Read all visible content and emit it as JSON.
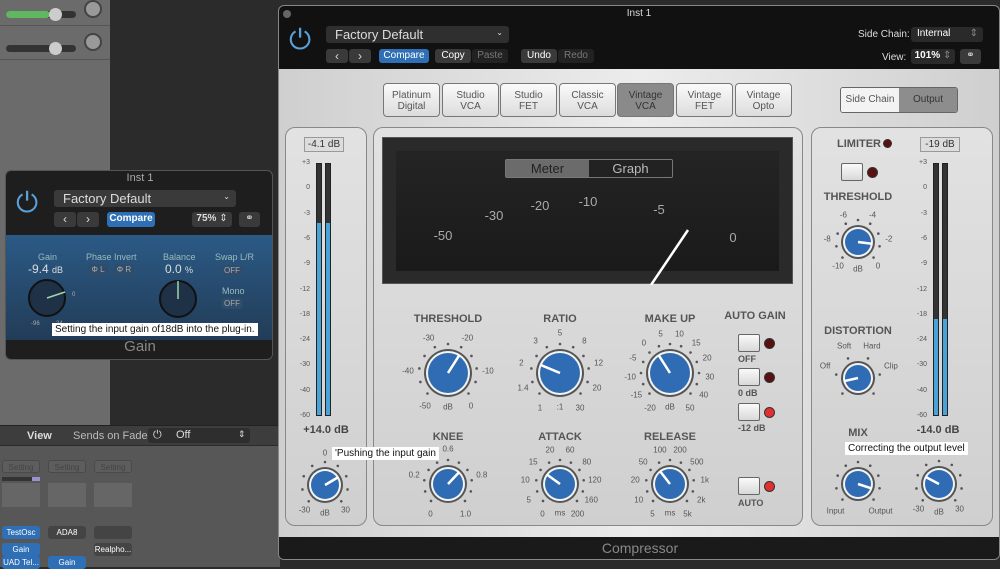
{
  "daw": {
    "mixer_bar": {
      "view_label": "View",
      "sends_label": "Sends on Faders:",
      "sends_value": "Off"
    },
    "strips": [
      {
        "setting": "Setting",
        "name": "TestOsc",
        "insert": "Gain",
        "insert2": "UAD Tel..."
      },
      {
        "setting": "Setting",
        "name": "ADA8",
        "insert": "Gain"
      },
      {
        "setting": "Setting",
        "name": "",
        "insert": "Realpho..."
      }
    ]
  },
  "gain_plugin": {
    "title": "Inst 1",
    "preset": "Factory Default",
    "compare": "Compare",
    "zoom": "75%",
    "gain_label": "Gain",
    "gain_value": "-9.4",
    "gain_unit": "dB",
    "gain_min": "-96",
    "gain_max": "24",
    "gain_zero": "0",
    "phase_label": "Phase Invert",
    "phase_l": "L",
    "phase_r": "R",
    "balance_label": "Balance",
    "balance_value": "0.0",
    "balance_unit": "%",
    "swap_label": "Swap L/R",
    "swap_value": "OFF",
    "mono_label": "Mono",
    "mono_value": "OFF",
    "footer": "Gain",
    "tooltip": "Setting the input gain of18dB into the plug-in."
  },
  "compressor": {
    "title": "Inst 1",
    "preset": "Factory Default",
    "compare": "Compare",
    "copy": "Copy",
    "paste": "Paste",
    "undo": "Undo",
    "redo": "Redo",
    "side_chain_label": "Side Chain:",
    "side_chain_value": "Internal",
    "view_label": "View:",
    "view_value": "101%",
    "models": [
      [
        "Platinum",
        "Digital"
      ],
      [
        "Studio",
        "VCA"
      ],
      [
        "Studio",
        "FET"
      ],
      [
        "Classic",
        "VCA"
      ],
      [
        "Vintage",
        "VCA"
      ],
      [
        "Vintage",
        "FET"
      ],
      [
        "Vintage",
        "Opto"
      ]
    ],
    "selected_model": "Vintage VCA",
    "view_tabs": [
      "Side Chain",
      "Output"
    ],
    "selected_view_tab": "Output",
    "meter_tabs": [
      "Meter",
      "Graph"
    ],
    "selected_meter_tab": "Meter",
    "vu_labels": [
      "-50",
      "-30",
      "-20",
      "-10",
      "-5",
      "0"
    ],
    "input": {
      "peak": "-4.1 dB",
      "gain": "+14.0 dB",
      "scale": [
        "+3",
        "0",
        "-3",
        "-6",
        "-9",
        "-12",
        "-18",
        "-24",
        "-30",
        "-40",
        "-60"
      ],
      "level_db": -4.1,
      "knob": {
        "labels": [
          "-30",
          "0",
          "30"
        ],
        "unit": "dB",
        "pos": 0.72
      }
    },
    "output": {
      "peak": "-19 dB",
      "gain": "-14.0 dB",
      "scale": [
        "+3",
        "0",
        "-3",
        "-6",
        "-9",
        "-12",
        "-18",
        "-24",
        "-30",
        "-40",
        "-60"
      ],
      "level_db": -19,
      "knob": {
        "labels": [
          "-30",
          "30"
        ],
        "unit": "dB",
        "pos": 0.27
      }
    },
    "knobs": {
      "threshold": {
        "label": "THRESHOLD",
        "labels": [
          "-50",
          "-40",
          "-30",
          "-20",
          "-10",
          "0"
        ],
        "unit": "dB",
        "pos": 0.62
      },
      "ratio": {
        "label": "RATIO",
        "labels": [
          "1",
          "1.4",
          "2",
          "3",
          "5",
          "8",
          "12",
          "20",
          "30"
        ],
        "unit": ":1",
        "pos": 0.25
      },
      "makeup": {
        "label": "MAKE UP",
        "labels": [
          "-20",
          "-15",
          "-10",
          "-5",
          "0",
          "5",
          "10",
          "15",
          "20",
          "30",
          "40",
          "50"
        ],
        "unit": "dB",
        "pos": 0.38
      },
      "knee": {
        "label": "KNEE",
        "labels": [
          "0",
          "0.2",
          "0.6",
          "0.8",
          "1.0"
        ],
        "unit": "",
        "pos": 0.66
      },
      "attack": {
        "label": "ATTACK",
        "labels": [
          "0",
          "5",
          "10",
          "15",
          "20",
          "60",
          "80",
          "120",
          "160",
          "200"
        ],
        "unit": "ms",
        "pos": 0.3
      },
      "release": {
        "label": "RELEASE",
        "labels": [
          "5",
          "10",
          "20",
          "50",
          "100",
          "200",
          "500",
          "1k",
          "2k",
          "5k"
        ],
        "unit": "ms",
        "pos": 0.36
      },
      "limiter_threshold": {
        "label": "THRESHOLD",
        "labels": [
          "-10",
          "-8",
          "-6",
          "-4",
          "-2",
          "0"
        ],
        "unit": "dB",
        "pos": 0.86
      },
      "distortion": {
        "label": "DISTORTION",
        "labels": [
          "Off",
          "Soft",
          "Hard",
          "Clip"
        ],
        "unit": "",
        "pos": 0.12
      },
      "mix": {
        "label": "MIX",
        "labels": [
          "Input",
          "Output"
        ],
        "unit": "",
        "pos": 0.9
      }
    },
    "auto_gain": {
      "label": "AUTO GAIN",
      "options": [
        "OFF",
        "0 dB",
        "-12 dB"
      ],
      "selected": "-12 dB",
      "auto": "AUTO",
      "auto_on": true
    },
    "limiter": {
      "label": "LIMITER",
      "on": false
    },
    "footer": "Compressor",
    "tooltip_input": "'Pushing the input gain",
    "tooltip_output": "Correcting the output level",
    "colors": {
      "knob": "#2f6cb3",
      "meter": "#4aa3d6",
      "accent": "#2e6fb5"
    }
  }
}
